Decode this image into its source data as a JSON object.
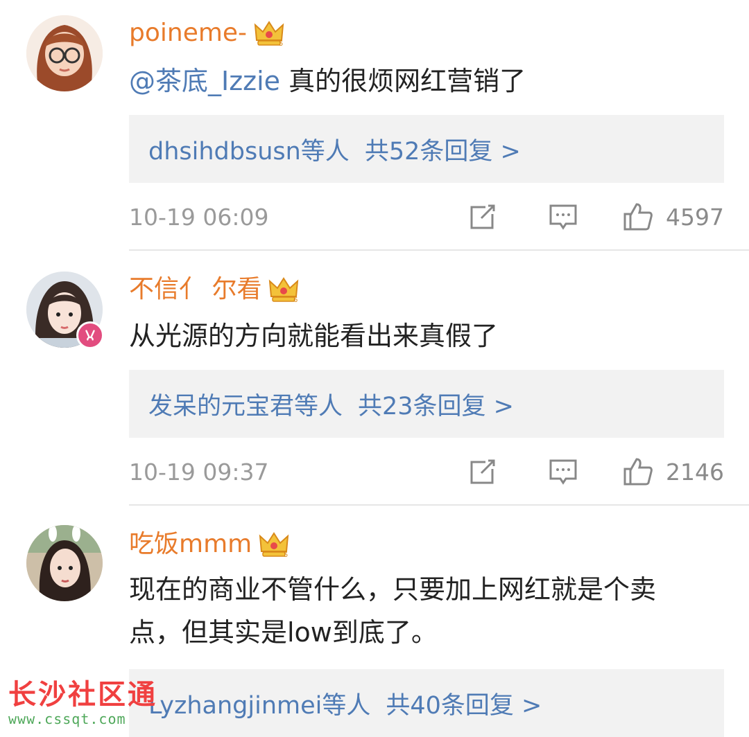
{
  "comments": [
    {
      "username": "poineme-",
      "mention": "@茶底_Izzie",
      "text": " 真的很烦网红营销了",
      "reply_users": "dhsihdbsusn等人",
      "reply_count": "共52条回复 >",
      "time": "10-19 06:09",
      "likes": "4597"
    },
    {
      "username": "不信亻 尔看",
      "mention": "",
      "text": "从光源的方向就能看出来真假了",
      "reply_users": "发呆的元宝君等人",
      "reply_count": "共23条回复 >",
      "time": "10-19 09:37",
      "likes": "2146"
    },
    {
      "username": "吃饭mmm",
      "mention": "",
      "text": "现在的商业不管什么，只要加上网红就是个卖点，但其实是low到底了。",
      "reply_users": "Lyzhangjinmei等人",
      "reply_count": "共40条回复 >"
    }
  ],
  "icons": {
    "share": "share-icon",
    "comment": "comment-icon",
    "like": "thumbs-up-icon",
    "crown": "crown-vip-icon",
    "badge": "verified-badge-icon"
  },
  "colors": {
    "username": "#e87b2b",
    "link": "#4f7bb5",
    "text": "#222222",
    "meta": "#9a9a9a",
    "reply_bg": "#f2f2f2"
  },
  "watermark": {
    "title": "长沙社区通",
    "url": "www.cssqt.com"
  }
}
